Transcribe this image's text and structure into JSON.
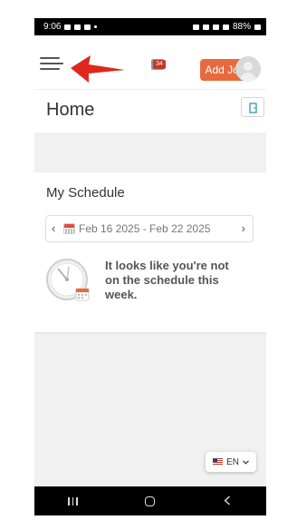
{
  "status_bar": {
    "time": "9:06",
    "battery": "88%"
  },
  "header": {
    "notification_count": "34",
    "add_job_label": "Add Job",
    "icons": {
      "menu": "hamburger-menu-icon",
      "arrow": "red-arrow-annotation-icon",
      "inbox": "inbox-icon",
      "avatar": "user-avatar-icon",
      "exit": "exit-door-icon"
    }
  },
  "page": {
    "title": "Home"
  },
  "schedule": {
    "title": "My Schedule",
    "prev": "‹",
    "next": "›",
    "week_range": "Feb 16 2025 - Feb 22 2025",
    "empty_message": "It looks like you're not on the schedule this week.",
    "icons": {
      "calendar": "calendar-icon",
      "clock": "clock-calendar-icon"
    }
  },
  "language": {
    "code": "EN",
    "flag": "us-flag-icon"
  },
  "colors": {
    "accent": "#e8693f",
    "badge": "#c0392b",
    "annotation_arrow": "#e0271b"
  }
}
